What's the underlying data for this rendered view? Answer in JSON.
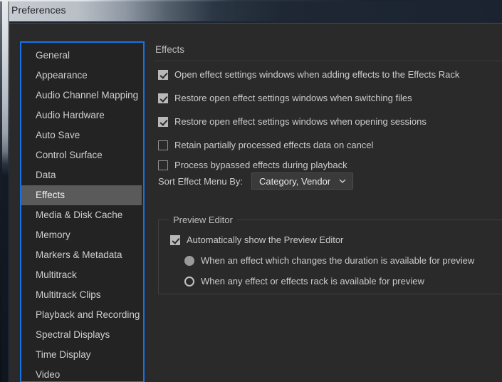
{
  "window": {
    "title": "Preferences"
  },
  "sidebar": {
    "items": [
      {
        "label": "General",
        "selected": false
      },
      {
        "label": "Appearance",
        "selected": false
      },
      {
        "label": "Audio Channel Mapping",
        "selected": false
      },
      {
        "label": "Audio Hardware",
        "selected": false
      },
      {
        "label": "Auto Save",
        "selected": false
      },
      {
        "label": "Control Surface",
        "selected": false
      },
      {
        "label": "Data",
        "selected": false
      },
      {
        "label": "Effects",
        "selected": true
      },
      {
        "label": "Media & Disk Cache",
        "selected": false
      },
      {
        "label": "Memory",
        "selected": false
      },
      {
        "label": "Markers & Metadata",
        "selected": false
      },
      {
        "label": "Multitrack",
        "selected": false
      },
      {
        "label": "Multitrack Clips",
        "selected": false
      },
      {
        "label": "Playback and Recording",
        "selected": false
      },
      {
        "label": "Spectral Displays",
        "selected": false
      },
      {
        "label": "Time Display",
        "selected": false
      },
      {
        "label": "Video",
        "selected": false
      }
    ]
  },
  "main": {
    "section_title": "Effects",
    "checkboxes": [
      {
        "label": "Open effect settings windows when adding effects to the Effects Rack",
        "checked": true
      },
      {
        "label": "Restore open effect settings windows when switching files",
        "checked": true
      },
      {
        "label": "Restore open effect settings windows when opening sessions",
        "checked": true
      },
      {
        "label": "Retain partially processed effects data on cancel",
        "checked": false
      },
      {
        "label": "Process bypassed effects during playback",
        "checked": false
      }
    ],
    "sort_menu": {
      "label": "Sort Effect Menu By:",
      "value": "Category, Vendor",
      "icon": "chevron-down-icon"
    },
    "preview_editor": {
      "legend": "Preview Editor",
      "auto_show": {
        "label": "Automatically show the Preview Editor",
        "checked": true
      },
      "radios": [
        {
          "label": "When an effect which changes the duration is available for preview",
          "selected": true
        },
        {
          "label": "When any effect or effects rack is available for preview",
          "selected": false
        }
      ]
    }
  },
  "colors": {
    "accent": "#1473e6",
    "panel_bg": "#2a2a2a",
    "sidebar_bg": "#232323",
    "selection": "#5a5a5a",
    "text": "#cccccc"
  }
}
